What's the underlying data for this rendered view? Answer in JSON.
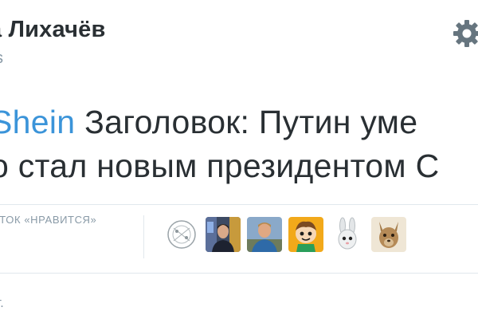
{
  "tweet": {
    "author_name": "а Лихачёв",
    "handle_fragment": "s",
    "text_lines": [
      {
        "mention": "Shein",
        "rest": " Заголовок: Путин уме"
      },
      {
        "text": "о стал новым президентом С"
      }
    ],
    "likes_label": "ЕТОК «НРАВИТСЯ»",
    "date_fragment": "г."
  },
  "avatars": [
    {
      "name": "avatar-sketch"
    },
    {
      "name": "avatar-man-room"
    },
    {
      "name": "avatar-man-street"
    },
    {
      "name": "avatar-cartoon"
    },
    {
      "name": "avatar-bunny"
    },
    {
      "name": "avatar-animal"
    }
  ],
  "icons": {
    "settings": "gear-icon"
  },
  "colors": {
    "text": "#292f33",
    "muted": "#8899a6",
    "link": "#3b94d9",
    "divider": "#e1e8ed"
  }
}
